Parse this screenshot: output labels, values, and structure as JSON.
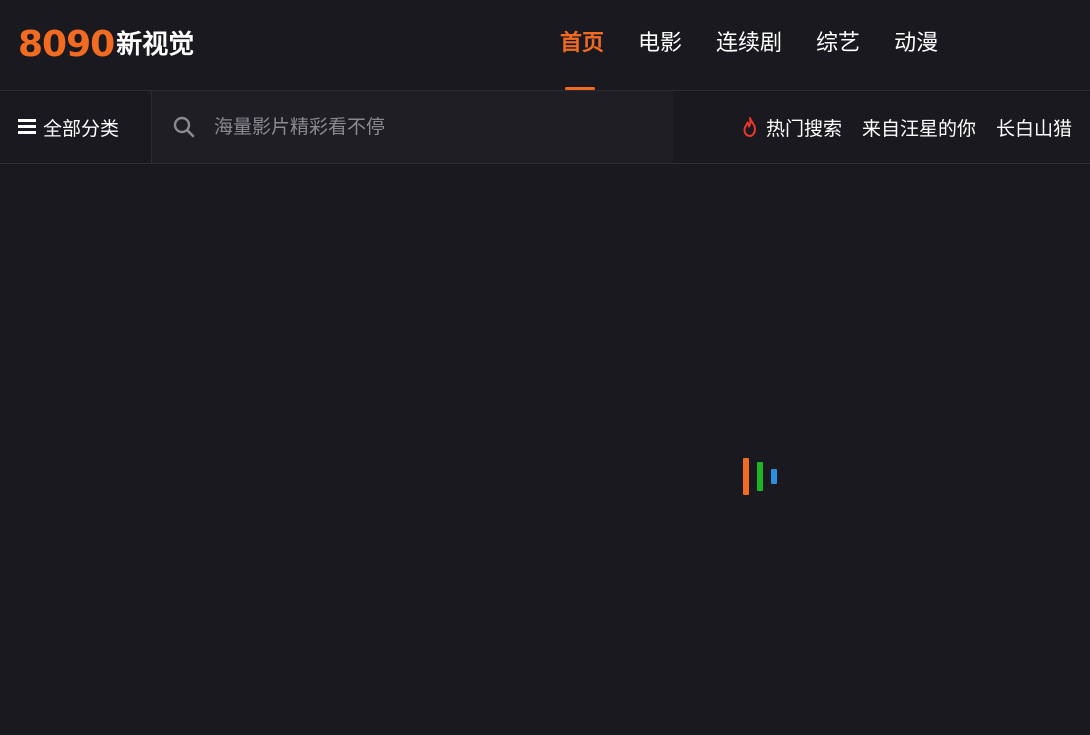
{
  "header": {
    "logo": {
      "number": "8090",
      "text": "新视觉"
    },
    "nav": [
      {
        "label": "首页",
        "active": true
      },
      {
        "label": "电影",
        "active": false
      },
      {
        "label": "连续剧",
        "active": false
      },
      {
        "label": "综艺",
        "active": false
      },
      {
        "label": "动漫",
        "active": false
      }
    ]
  },
  "subbar": {
    "category_label": "全部分类",
    "search": {
      "placeholder": "海量影片精彩看不停",
      "value": ""
    },
    "hot": {
      "label": "热门搜索",
      "terms": [
        "来自汪星的你",
        "长白山猎"
      ]
    }
  },
  "loader": {
    "colors": [
      "#f26b22",
      "#1db527",
      "#2b8fe0"
    ]
  },
  "theme": {
    "accent": "#f26b22",
    "background": "#1a191f",
    "search_bg": "#1f1e24",
    "fire": "#e8362a"
  }
}
